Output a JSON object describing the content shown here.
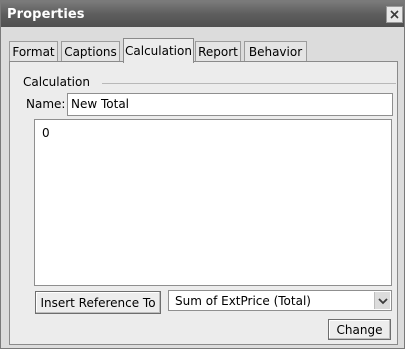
{
  "window": {
    "title": "Properties",
    "close_icon": "close-icon"
  },
  "tabs": [
    {
      "label": "Format",
      "active": false
    },
    {
      "label": "Captions",
      "active": false
    },
    {
      "label": "Calculation",
      "active": true
    },
    {
      "label": "Report",
      "active": false
    },
    {
      "label": "Behavior",
      "active": false
    }
  ],
  "calculation": {
    "group_label": "Calculation",
    "name_label": "Name:",
    "name_value": "New Total",
    "expression": "0",
    "insert_button": "Insert Reference To",
    "reference_selected": "Sum of ExtPrice (Total)",
    "change_button": "Change"
  },
  "colors": {
    "titlebar": "#5e5e5e",
    "panel": "#ececec"
  }
}
